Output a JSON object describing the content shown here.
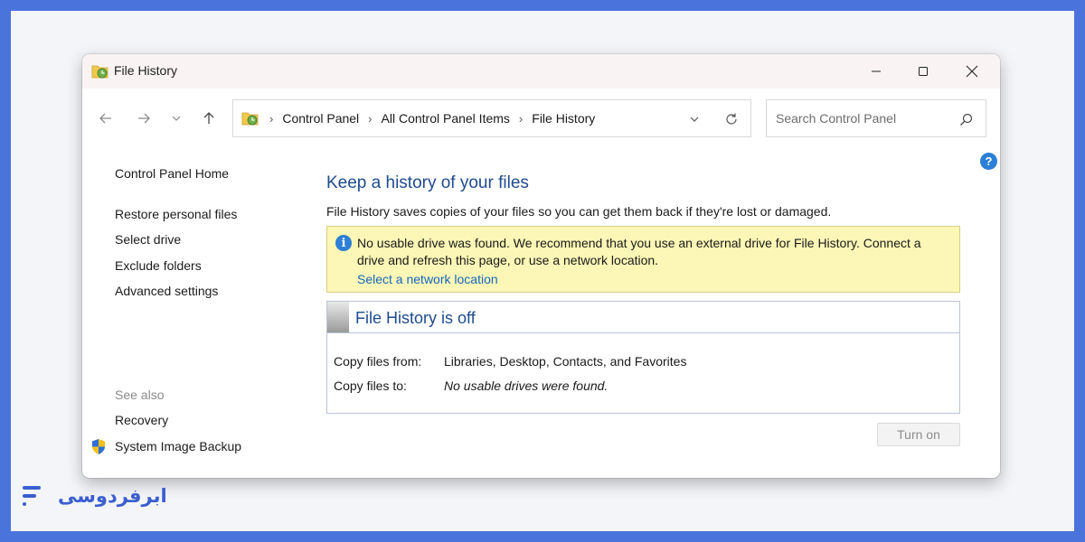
{
  "window": {
    "title": "File History",
    "controls": [
      "minimize",
      "maximize",
      "close"
    ]
  },
  "navigation": {
    "breadcrumbs": [
      "Control Panel",
      "All Control Panel Items",
      "File History"
    ],
    "search_placeholder": "Search Control Panel"
  },
  "sidebar": {
    "home_link": "Control Panel Home",
    "links": [
      "Restore personal files",
      "Select drive",
      "Exclude folders",
      "Advanced settings"
    ],
    "see_also_label": "See also",
    "see_also_links": [
      "Recovery",
      "System Image Backup"
    ]
  },
  "main": {
    "heading": "Keep a history of your files",
    "description": "File History saves copies of your files so you can get them back if they're lost or damaged.",
    "info": {
      "message": "No usable drive was found. We recommend that you use an external drive for File History. Connect a drive and refresh this page, or use a network location.",
      "link": "Select a network location"
    },
    "status": {
      "title": "File History is off",
      "copy_from_label": "Copy files from:",
      "copy_from_value": "Libraries, Desktop, Contacts, and Favorites",
      "copy_to_label": "Copy files to:",
      "copy_to_value": "No usable drives were found."
    },
    "turn_on_button": "Turn on"
  },
  "brand": {
    "name": "ابرفردوسی"
  },
  "colors": {
    "page_border": "#4a74dc",
    "heading_blue": "#1e4b8f",
    "link_blue": "#1566c0",
    "info_background": "#fcf7b6",
    "info_icon": "#2c7fd6"
  }
}
